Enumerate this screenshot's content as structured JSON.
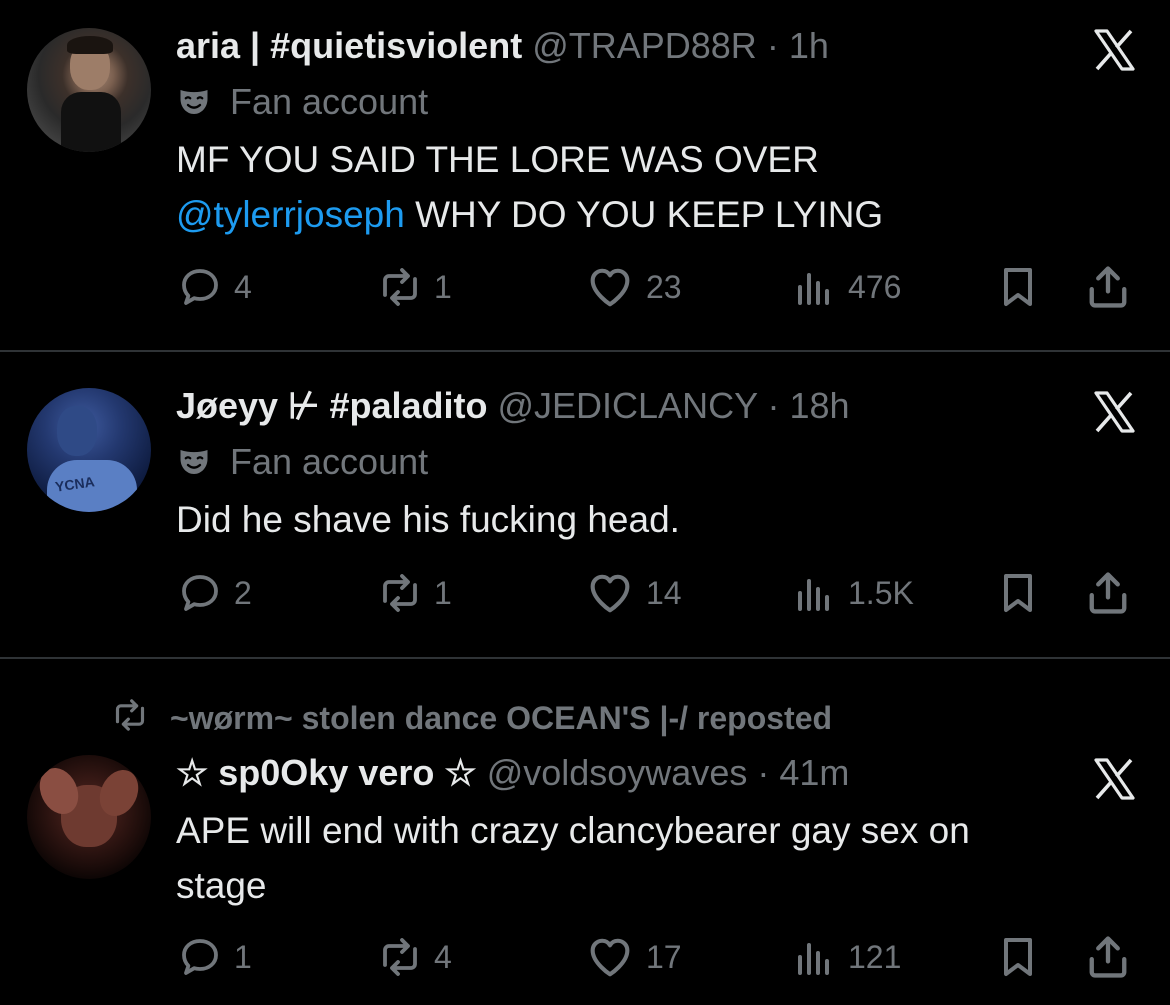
{
  "tweets": [
    {
      "name": "aria | #quietisviolent",
      "handle": "@TRAPD88R",
      "time": "· 1h",
      "label": "Fan account",
      "text_line1": "MF YOU SAID THE LORE WAS OVER",
      "mention": "@tylerrjoseph",
      "text_after_mention": " WHY DO YOU KEEP LYING",
      "replies": "4",
      "reposts": "1",
      "likes": "23",
      "views": "476"
    },
    {
      "name": "Jøeyy ⊬ #paladito",
      "handle": "@JEDICLANCY",
      "time": "· 18h",
      "label": "Fan account",
      "text": "Did he shave his fucking head.",
      "replies": "2",
      "reposts": "1",
      "likes": "14",
      "views": "1.5K"
    },
    {
      "repost_context": "~wørm~ stolen dance OCEAN'S |-/ reposted",
      "name": "☆ sp0Oky vero ☆",
      "handle": "@voldsoywaves",
      "time": "· 41m",
      "text_line1": "APE will end with crazy clancybearer gay sex on",
      "text_line2": "stage",
      "replies": "1",
      "reposts": "4",
      "likes": "17",
      "views": "121"
    }
  ],
  "icons": {
    "reply": "reply-icon",
    "repost": "repost-icon",
    "like": "heart-icon",
    "views": "views-icon",
    "bookmark": "bookmark-icon",
    "share": "share-icon",
    "more": "x-logo-icon",
    "label": "mask-icon"
  },
  "colors": {
    "background": "#000000",
    "text": "#e7e9ea",
    "secondary": "#71767b",
    "link": "#1d9bf0",
    "divider": "#2f3336"
  }
}
